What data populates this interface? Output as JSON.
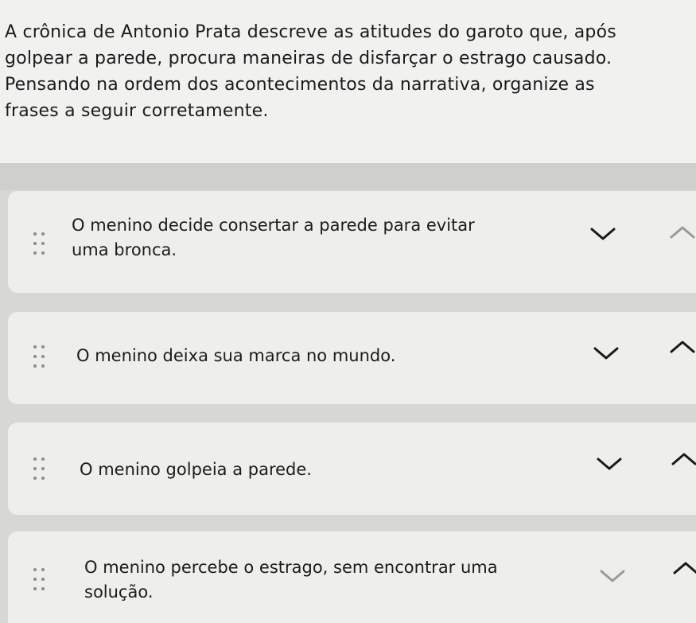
{
  "question": {
    "lines": [
      "A crônica de Antonio Prata descreve as atitudes do garoto que, após",
      "golpear a parede, procura maneiras de disfarçar o estrago causado.",
      "Pensando na ordem dos acontecimentos da narrativa, organize as",
      "frases a seguir corretamente."
    ]
  },
  "items": [
    {
      "lines": [
        "O menino decide consertar a parede para evitar",
        "uma bronca."
      ]
    },
    {
      "lines": [
        "O menino deixa sua marca no mundo."
      ]
    },
    {
      "lines": [
        "O menino golpeia a parede."
      ]
    },
    {
      "lines": [
        "O menino percebe o estrago, sem encontrar uma",
        "solução."
      ]
    }
  ],
  "icons": {
    "move_down": "chevron-down-icon",
    "move_up": "chevron-up-icon",
    "drag": "drag-handle-icon"
  },
  "colors": {
    "page_background": "#d7d8d6",
    "card_background": "#eeefec",
    "text": "#1b1b1b"
  }
}
